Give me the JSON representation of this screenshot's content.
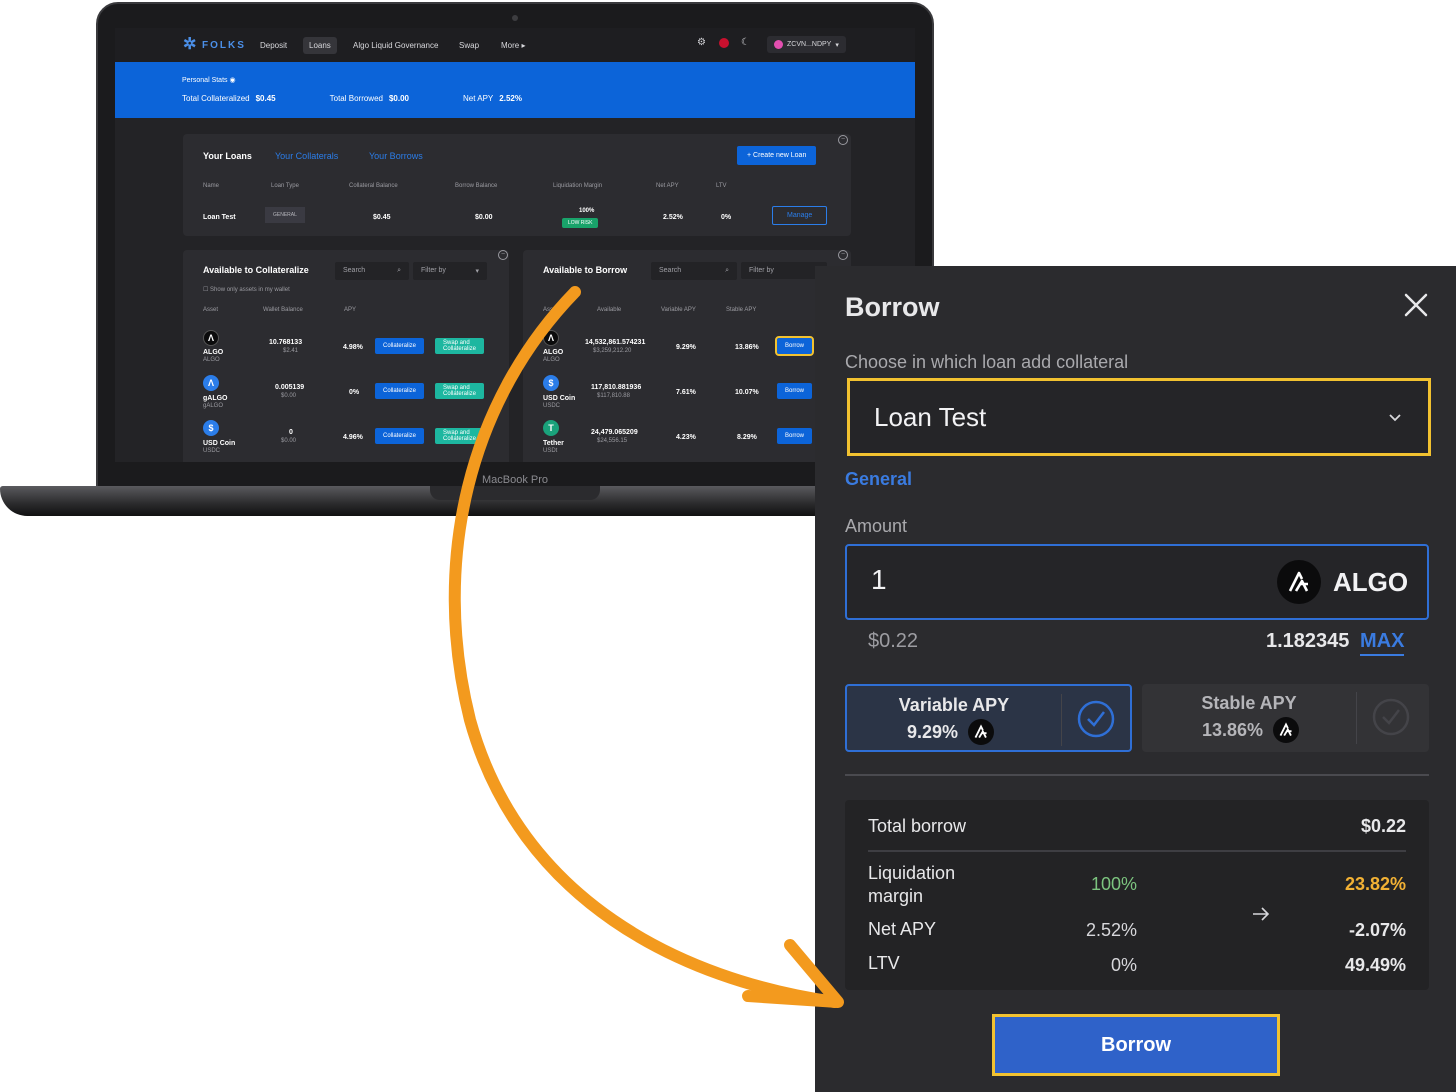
{
  "laptop": {
    "device_label": "MacBook Pro",
    "app": {
      "logo": "FOLKS",
      "nav": [
        "Deposit",
        "Loans",
        "Algo Liquid Governance",
        "Swap",
        "More"
      ],
      "nav_active": "Loans",
      "wallet": "ZCVN...NDPY",
      "icons": [
        "gear-icon",
        "flag-icon",
        "moon-icon"
      ]
    },
    "stats": {
      "label": "Personal Stats",
      "total_collateralized_label": "Total Collateralized",
      "total_collateralized": "$0.45",
      "total_borrowed_label": "Total Borrowed",
      "total_borrowed": "$0.00",
      "net_apy_label": "Net APY",
      "net_apy": "2.52%"
    },
    "loans": {
      "tabs": [
        "Your Loans",
        "Your Collaterals",
        "Your Borrows"
      ],
      "create_button": "+ Create new Loan",
      "columns": [
        "Name",
        "Loan Type",
        "Collateral Balance",
        "Borrow Balance",
        "Liquidation Margin",
        "Net APY",
        "LTV"
      ],
      "row": {
        "name": "Loan Test",
        "type": "GENERAL",
        "collateral": "$0.45",
        "borrow": "$0.00",
        "margin": "100%",
        "risk": "LOW RISK",
        "net_apy": "2.52%",
        "ltv": "0%",
        "action": "Manage"
      }
    },
    "collateralize": {
      "title": "Available to Collateralize",
      "search": "Search",
      "filter": "Filter by",
      "checkbox": "Show only assets in my wallet",
      "columns": [
        "Asset",
        "Wallet Balance",
        "APY"
      ],
      "rows": [
        {
          "name": "ALGO",
          "sub": "ALGO",
          "balance": "10.768133",
          "usd": "$2.41",
          "apy": "4.98%"
        },
        {
          "name": "gALGO",
          "sub": "gALGO",
          "balance": "0.005139",
          "usd": "$0.00",
          "apy": "0%"
        },
        {
          "name": "USD Coin",
          "sub": "USDC",
          "balance": "0",
          "usd": "$0.00",
          "apy": "4.96%"
        }
      ],
      "btn_collateralize": "Collateralize",
      "btn_swap_line1": "Swap and",
      "btn_swap_line2": "Collateralize"
    },
    "borrow_list": {
      "title": "Available to Borrow",
      "search": "Search",
      "filter": "Filter by",
      "columns": [
        "Asset",
        "Available",
        "Variable APY",
        "Stable APY"
      ],
      "rows": [
        {
          "name": "ALGO",
          "sub": "ALGO",
          "available": "14,532,861.574231",
          "usd": "$3,259,212.20",
          "var": "9.29%",
          "stable": "13.86%"
        },
        {
          "name": "USD Coin",
          "sub": "USDC",
          "available": "117,810.881936",
          "usd": "$117,810.88",
          "var": "7.61%",
          "stable": "10.07%"
        },
        {
          "name": "Tether",
          "sub": "USDt",
          "available": "24,479.065209",
          "usd": "$24,556.15",
          "var": "4.23%",
          "stable": "8.29%"
        }
      ],
      "btn_borrow": "Borrow"
    }
  },
  "modal": {
    "title": "Borrow",
    "choose_label": "Choose in which loan add collateral",
    "selected_loan": "Loan Test",
    "loan_type": "General",
    "amount_label": "Amount",
    "amount": "1",
    "token": "ALGO",
    "amount_usd": "$0.22",
    "balance": "1.182345",
    "max": "MAX",
    "variable_apy_label": "Variable APY",
    "variable_apy": "9.29%",
    "stable_apy_label": "Stable APY",
    "stable_apy": "13.86%",
    "total_borrow_label": "Total borrow",
    "total_borrow": "$0.22",
    "liq_label_1": "Liquidation",
    "liq_label_2": "margin",
    "liq_current": "100%",
    "liq_new": "23.82%",
    "net_apy_label": "Net APY",
    "net_apy_current": "2.52%",
    "net_apy_new": "-2.07%",
    "ltv_label": "LTV",
    "ltv_current": "0%",
    "ltv_new": "49.49%",
    "borrow_button": "Borrow"
  },
  "colors": {
    "accent_blue": "#2f6fd6",
    "highlight_yellow": "#f2c230",
    "positive_green": "#7cc47f",
    "warning_orange": "#f2b134",
    "arrow_orange": "#f39a1e"
  }
}
